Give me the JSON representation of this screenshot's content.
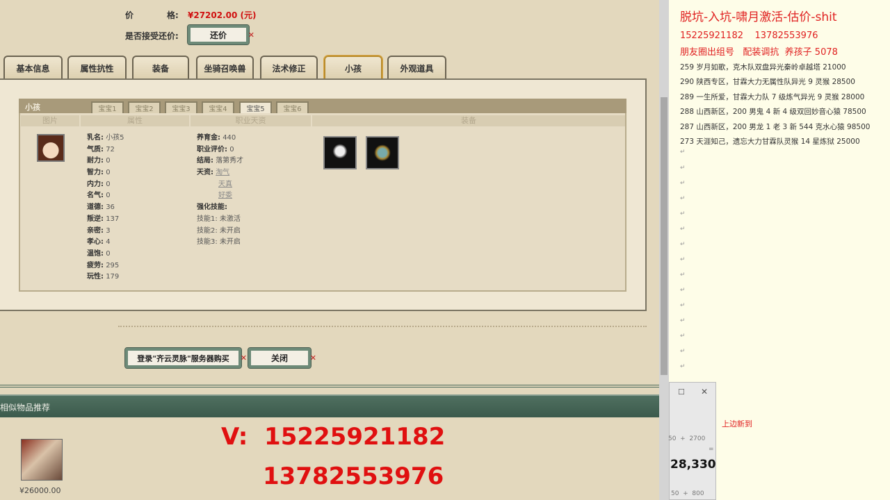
{
  "listing": {
    "price_label_a": "价",
    "price_label_b": "格:",
    "price_value": "¥27202.00 (元)",
    "counter_offer_label": "是否接受还价:",
    "counter_offer_button": "还价"
  },
  "tabs": [
    "基本信息",
    "属性抗性",
    "装备",
    "坐骑召唤兽",
    "法术修正",
    "小孩",
    "外观道具"
  ],
  "child_panel": {
    "title": "小孩",
    "subtabs": [
      "宝宝1",
      "宝宝2",
      "宝宝3",
      "宝宝4",
      "宝宝5",
      "宝宝6"
    ],
    "columns": [
      "图片",
      "属性",
      "职业天资",
      "装备"
    ],
    "attributes": [
      [
        "乳名:",
        "小孩5"
      ],
      [
        "气质:",
        "72"
      ],
      [
        "耐力:",
        "0"
      ],
      [
        "智力:",
        "0"
      ],
      [
        "内力:",
        "0"
      ],
      [
        "名气:",
        "0"
      ],
      [
        "道德:",
        "36"
      ],
      [
        "叛逆:",
        "137"
      ],
      [
        "亲密:",
        "3"
      ],
      [
        "孝心:",
        "4"
      ],
      [
        "温饱:",
        "0"
      ],
      [
        "疲劳:",
        "295"
      ],
      [
        "玩性:",
        "179"
      ]
    ],
    "career": [
      [
        "养育金:",
        "440"
      ],
      [
        "职业评价:",
        "0"
      ],
      [
        "结局:",
        "落第秀才"
      ]
    ],
    "talent_label": "天资:",
    "talents": [
      "淘气",
      "天真",
      "好委"
    ],
    "skills_label": "强化技能:",
    "skills": [
      [
        "技能1:",
        "未激活"
      ],
      [
        "技能2:",
        "未开启"
      ],
      [
        "技能3:",
        "未开启"
      ]
    ]
  },
  "buttons": {
    "buy": "登录\"齐云灵脉\"服务器购买",
    "close": "关闭"
  },
  "recommend": {
    "title": "相似物品推荐",
    "item_price": "¥26000.00"
  },
  "overlay": {
    "line1": "V:  15225921182",
    "line2": "13782553976"
  },
  "notepad": {
    "title": "脱坑-入坑-啸月激活-估价-shit",
    "phones": "15225921182    13782553976",
    "subtitle": "朋友圈出组号   配装调抗  养孩子 5078",
    "lines": [
      "259 岁月如歌，克木队双盘异光秦岭卓越塔 21000",
      "290 陕西专区，甘霖大力无属性队异光 9 灵猴 28500",
      "289 一生所爱，甘霖大力队 7 级炼气异光 9 灵猴 28000",
      "288 山西新区，200 男鬼 4 新 4 级双回妙音心猿 78500",
      "287 山西新区，200 男龙 1 老 3 新 544 克水心猿 98500",
      "273 天涯知己，遗忘大力甘霖队灵猴 14 星炼狱 25000"
    ],
    "note_red": "上边新到"
  },
  "calculator": {
    "expr1": "50  +  2700",
    "eq": "=",
    "result": "28,330",
    "expr2": "50  +  800"
  }
}
